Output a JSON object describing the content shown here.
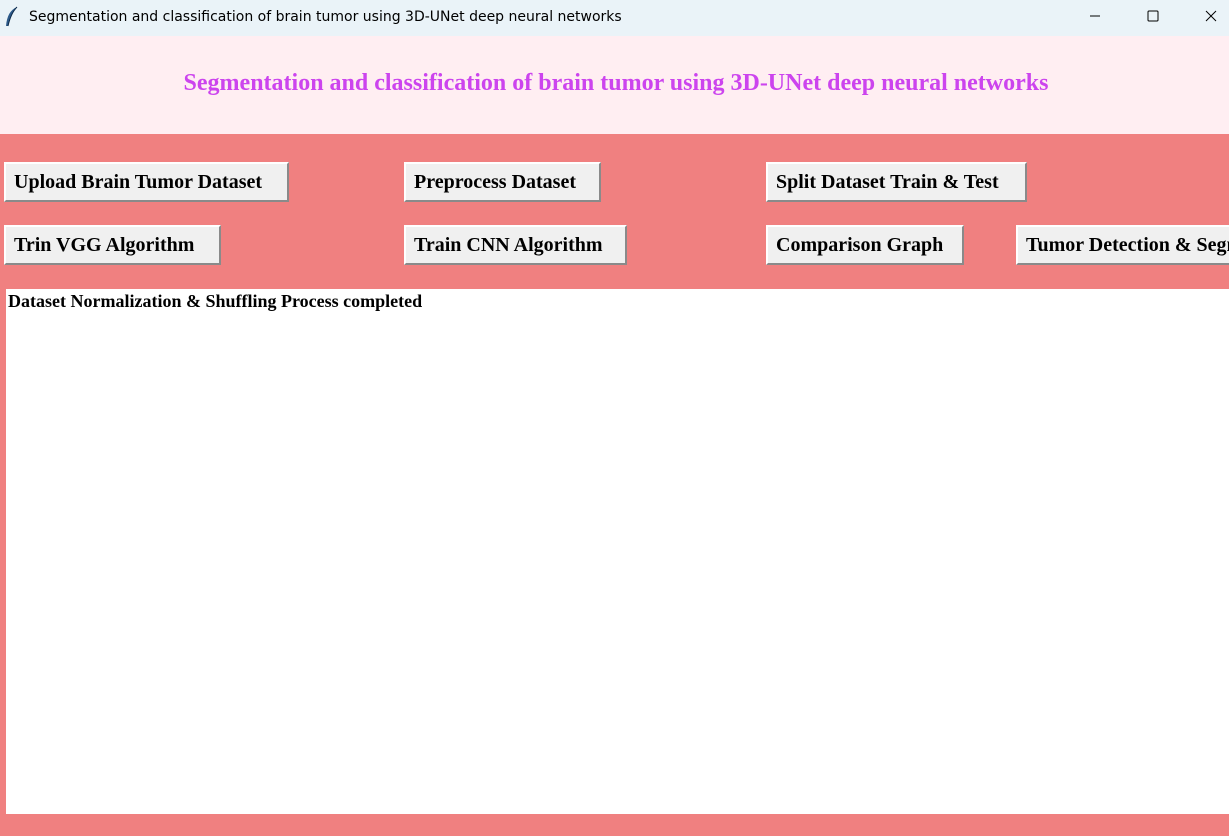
{
  "window": {
    "title": "Segmentation and classification of brain tumor using 3D-UNet deep neural networks",
    "controls": {
      "minimize_icon": "minimize-icon",
      "maximize_icon": "maximize-icon",
      "close_icon": "close-icon"
    }
  },
  "header": {
    "title": "Segmentation and classification of brain tumor using 3D-UNet deep neural networks",
    "background": "#ffeef2",
    "title_color": "#cc44ee"
  },
  "buttons": {
    "upload": "Upload Brain Tumor Dataset",
    "preprocess": "Preprocess Dataset",
    "split": "Split Dataset Train & Test",
    "vgg": "Trin VGG Algorithm",
    "cnn": "Train CNN Algorithm",
    "graph": "Comparison Graph",
    "detection": "Tumor Detection & Segmentation"
  },
  "output": {
    "text": "Dataset Normalization & Shuffling Process completed"
  },
  "colors": {
    "body_background": "#f08080",
    "button_face": "#f0f0f0",
    "titlebar": "#eaf3f8"
  }
}
